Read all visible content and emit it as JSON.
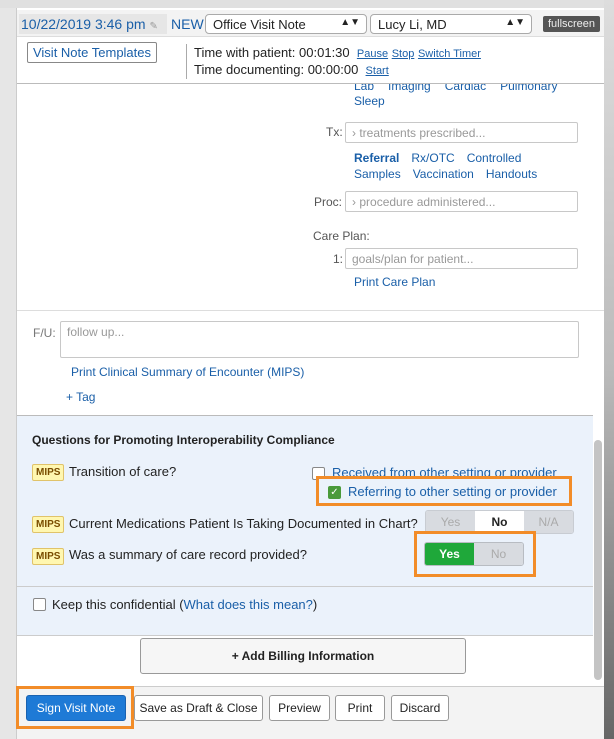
{
  "header": {
    "datetime": "10/22/2019 3:46 pm",
    "status": "NEW",
    "note_type": "Office Visit Note",
    "provider": "Lucy Li, MD",
    "fullscreen": "fullscreen"
  },
  "timer": {
    "templates_button": "Visit Note Templates",
    "patient_label": "Time with patient:",
    "patient_time": "00:01:30",
    "pause": "Pause",
    "stop": "Stop",
    "switch": "Switch Timer",
    "doc_label": "Time documenting:",
    "doc_time": "00:00:00",
    "start": "Start"
  },
  "orders": {
    "row1": [
      "Lab",
      "Imaging",
      "Cardiac",
      "Pulmonary"
    ],
    "row2": [
      "Sleep"
    ]
  },
  "tx": {
    "label": "Tx:",
    "placeholder": "treatments prescribed...",
    "links1": [
      "Referral",
      "Rx/OTC",
      "Controlled"
    ],
    "links2": [
      "Samples",
      "Vaccination",
      "Handouts"
    ]
  },
  "proc": {
    "label": "Proc:",
    "placeholder": "procedure administered..."
  },
  "care_plan": {
    "label": "Care Plan:",
    "num": "1:",
    "placeholder": "goals/plan for patient...",
    "print": "Print Care Plan"
  },
  "fu": {
    "label": "F/U:",
    "placeholder": "follow up...",
    "print_summary": "Print Clinical Summary of Encounter (MIPS)",
    "tag": "+ Tag"
  },
  "questions": {
    "title": "Questions for Promoting Interoperability Compliance",
    "badge": "MIPS",
    "q1": "Transition of care?",
    "q1_opt1": "Received from other setting or provider",
    "q1_opt2": "Referring to other setting or provider",
    "q2": "Current Medications Patient Is Taking Documented in Chart?",
    "q2_opts": [
      "Yes",
      "No",
      "N/A"
    ],
    "q2_selected": "No",
    "q3": "Was a summary of care record provided?",
    "q3_opts": [
      "Yes",
      "No"
    ],
    "q3_selected": "Yes"
  },
  "confidential": {
    "label": "Keep this confidential (",
    "link": "What does this mean?",
    "close": ")"
  },
  "billing": "+ Add Billing Information",
  "footer": {
    "sign": "Sign Visit Note",
    "draft": "Save as Draft & Close",
    "preview": "Preview",
    "print": "Print",
    "discard": "Discard"
  },
  "colors": {
    "accent": "#1a5fa8",
    "highlight": "#f28c28",
    "yes_green": "#1fa83a",
    "sign_blue": "#1e7ad6"
  }
}
